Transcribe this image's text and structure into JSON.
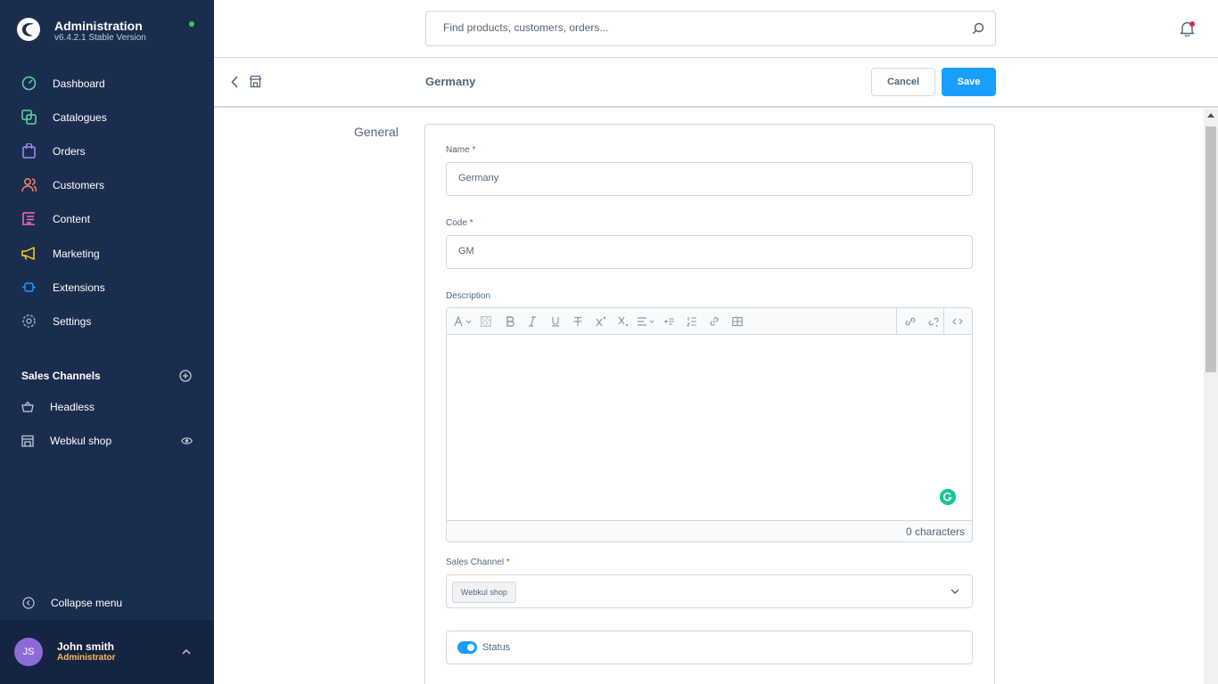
{
  "app": {
    "title": "Administration",
    "version": "v6.4.2.1 Stable Version"
  },
  "sidebar": {
    "items": [
      {
        "label": "Dashboard",
        "icon": "dashboard-icon",
        "color": "#57d9a3"
      },
      {
        "label": "Catalogues",
        "icon": "catalogues-icon",
        "color": "#57d9a3"
      },
      {
        "label": "Orders",
        "icon": "orders-icon",
        "color": "#a092f0"
      },
      {
        "label": "Customers",
        "icon": "customers-icon",
        "color": "#f88962"
      },
      {
        "label": "Content",
        "icon": "content-icon",
        "color": "#ff68b4"
      },
      {
        "label": "Marketing",
        "icon": "marketing-icon",
        "color": "#ffd700"
      },
      {
        "label": "Extensions",
        "icon": "extensions-icon",
        "color": "#189eff"
      },
      {
        "label": "Settings",
        "icon": "settings-icon",
        "color": "#9aa8b5"
      }
    ],
    "sales_channels": {
      "heading": "Sales Channels",
      "items": [
        {
          "label": "Headless"
        },
        {
          "label": "Webkul shop"
        }
      ]
    },
    "collapse_label": "Collapse menu",
    "user": {
      "initials": "JS",
      "name": "John smith",
      "role": "Administrator"
    }
  },
  "search": {
    "placeholder": "Find products, customers, orders..."
  },
  "smartbar": {
    "title": "Germany",
    "cancel_label": "Cancel",
    "save_label": "Save"
  },
  "form": {
    "section_label": "General",
    "name": {
      "label": "Name",
      "required": "*",
      "value": "Germany"
    },
    "code": {
      "label": "Code",
      "required": "*",
      "value": "GM"
    },
    "description": {
      "label": "Description",
      "char_count": "0 characters"
    },
    "sales_channel": {
      "label": "Sales Channel",
      "required": "*",
      "selected": "Webkul shop"
    },
    "status": {
      "label": "Status",
      "enabled": true
    }
  },
  "colors": {
    "sidebar_bg": "#1b2d4f",
    "primary": "#189eff",
    "required": "#de294c",
    "role": "#ffb75d"
  }
}
